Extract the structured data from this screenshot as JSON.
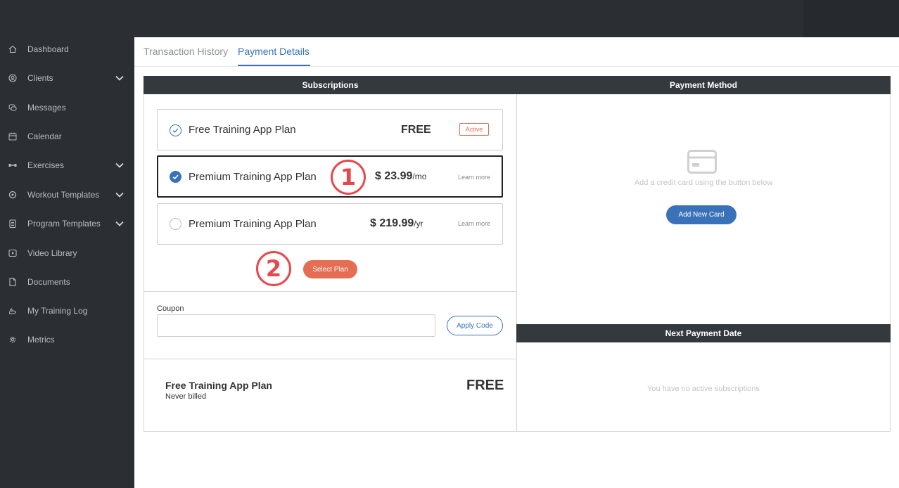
{
  "sidebar": {
    "items": [
      {
        "label": "Dashboard",
        "icon": "home-icon",
        "chevron": false
      },
      {
        "label": "Clients",
        "icon": "user-circle-icon",
        "chevron": true
      },
      {
        "label": "Messages",
        "icon": "chat-icon",
        "chevron": false
      },
      {
        "label": "Calendar",
        "icon": "calendar-icon",
        "chevron": false
      },
      {
        "label": "Exercises",
        "icon": "dumbbell-icon",
        "chevron": true
      },
      {
        "label": "Workout Templates",
        "icon": "badge-icon",
        "chevron": true
      },
      {
        "label": "Program Templates",
        "icon": "clipboard-icon",
        "chevron": true
      },
      {
        "label": "Video Library",
        "icon": "video-icon",
        "chevron": false
      },
      {
        "label": "Documents",
        "icon": "document-icon",
        "chevron": false
      },
      {
        "label": "My Training Log",
        "icon": "muscle-icon",
        "chevron": false
      },
      {
        "label": "Metrics",
        "icon": "gear-icon",
        "chevron": false
      }
    ]
  },
  "tabs": {
    "transaction_history": "Transaction History",
    "payment_details": "Payment Details"
  },
  "subscriptions": {
    "header": "Subscriptions",
    "plans": [
      {
        "name": "Free Training App Plan",
        "price": "FREE",
        "unit": "",
        "badge": "Active",
        "state": "active"
      },
      {
        "name": "Premium Training App Plan",
        "price": "$ 23.99",
        "unit": "/mo",
        "link": "Learn more",
        "state": "selected"
      },
      {
        "name": "Premium Training App Plan",
        "price": "$ 219.99",
        "unit": "/yr",
        "link": "Learn more",
        "state": "unselected"
      }
    ],
    "select_button": "Select Plan",
    "annotations": [
      "1",
      "2"
    ]
  },
  "coupon": {
    "label": "Coupon",
    "value": "",
    "placeholder": "",
    "apply_button": "Apply Code"
  },
  "current_plan": {
    "name": "Free Training App Plan",
    "billing": "Never billed",
    "price": "FREE"
  },
  "payment_method": {
    "header": "Payment Method",
    "empty_text": "Add a credit card using the button below",
    "add_button": "Add New Card",
    "icon": "credit-card-icon"
  },
  "next_payment": {
    "header": "Next Payment Date",
    "empty_text": "You have no active subscriptions"
  },
  "colors": {
    "sidebar_bg": "#2b2f33",
    "accent_blue": "#3a72b9",
    "accent_orange": "#e56d53",
    "annotation_red": "#e8474c"
  }
}
